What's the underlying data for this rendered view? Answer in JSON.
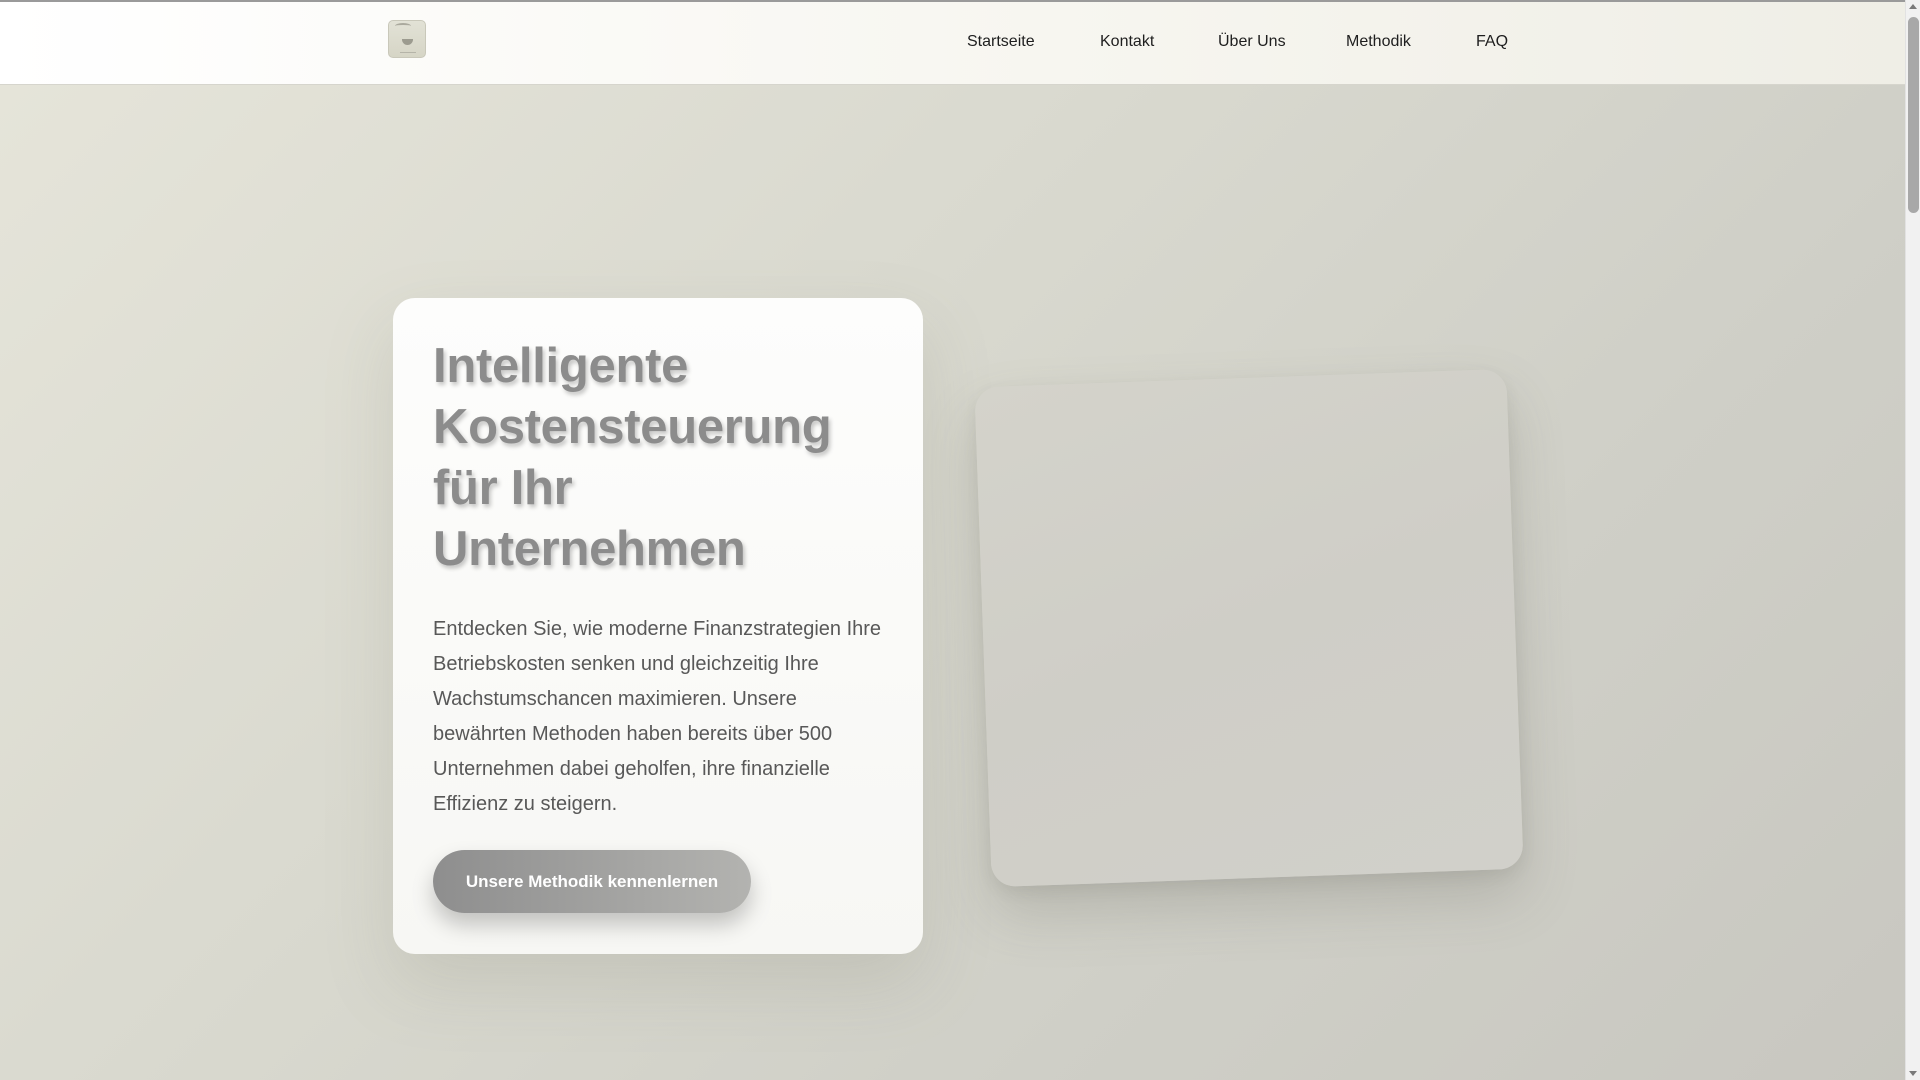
{
  "header": {
    "logo_icon": "bird-logo-icon",
    "nav": [
      {
        "label": "Startseite"
      },
      {
        "label": "Kontakt"
      },
      {
        "label": "Über Uns"
      },
      {
        "label": "Methodik"
      },
      {
        "label": "FAQ"
      }
    ]
  },
  "hero": {
    "title": "Intelligente Kostensteuerung für Ihr Unternehmen",
    "text": "Entdecken Sie, wie moderne Finanzstrategien Ihre Betriebskosten senken und gleichzeitig Ihre Wachstumschancen maximieren. Unsere bewährten Methoden haben bereits über 500 Unternehmen dabei geholfen, ihre finanzielle Effizienz zu steigern.",
    "cta_label": "Unsere Methodik kennenlernen"
  },
  "colors": {
    "background": "#d9d9cf",
    "card": "#fbfbf9",
    "title": "#8c8c8c",
    "button": "#9e9e9c"
  }
}
